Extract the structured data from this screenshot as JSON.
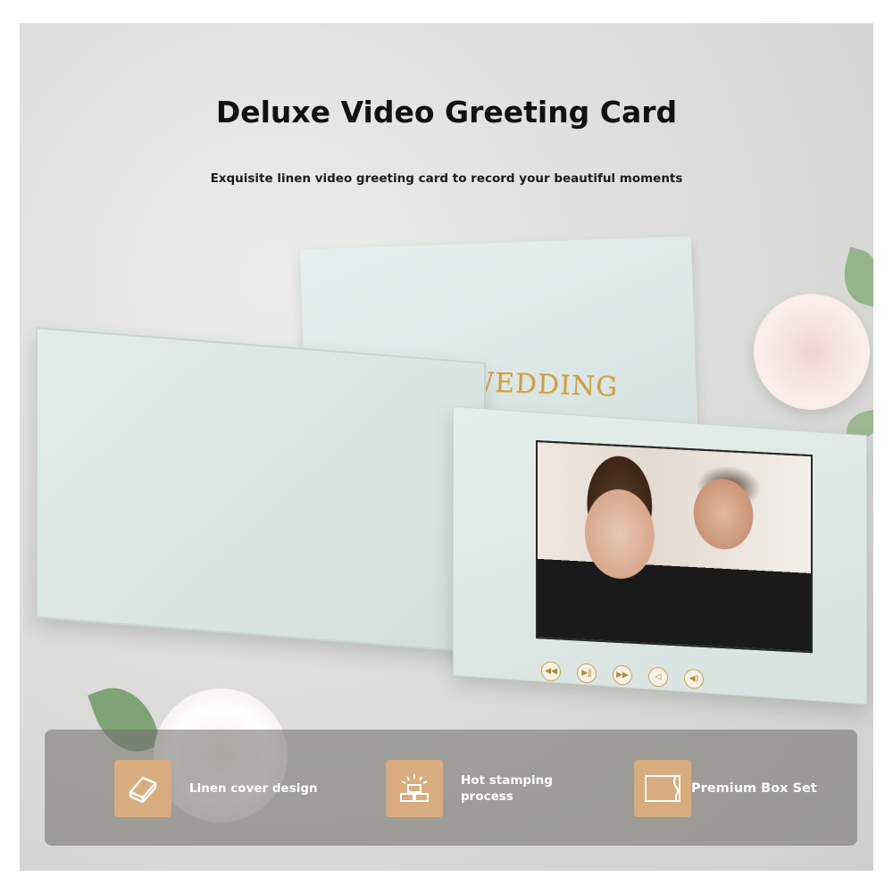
{
  "header": {
    "title": "Deluxe Video Greeting Card",
    "subtitle": "Exquisite linen video greeting card to record your beautiful moments"
  },
  "product": {
    "cover_text": "OUR WEDDING",
    "screen_image": "bride-and-groom-photo",
    "controls": [
      {
        "icon": "rewind-icon",
        "glyph": "◀◀"
      },
      {
        "icon": "play-pause-icon",
        "glyph": "▶‖"
      },
      {
        "icon": "fast-forward-icon",
        "glyph": "▶▶"
      },
      {
        "icon": "volume-down-icon",
        "glyph": "◁"
      },
      {
        "icon": "volume-up-icon",
        "glyph": "◀)"
      }
    ],
    "card_color": "#dde7e4",
    "foil_color": "#c9a04a"
  },
  "features": [
    {
      "icon": "linen-cover-icon",
      "label": "Linen cover design"
    },
    {
      "icon": "gold-bars-icon",
      "label": "Hot stamping\nprocess"
    },
    {
      "icon": "box-icon",
      "label": "Premium Box Set"
    }
  ],
  "colors": {
    "icon_box": "#d7ad7f",
    "feature_bar": "#6e6c68",
    "title_text": "#111111"
  }
}
